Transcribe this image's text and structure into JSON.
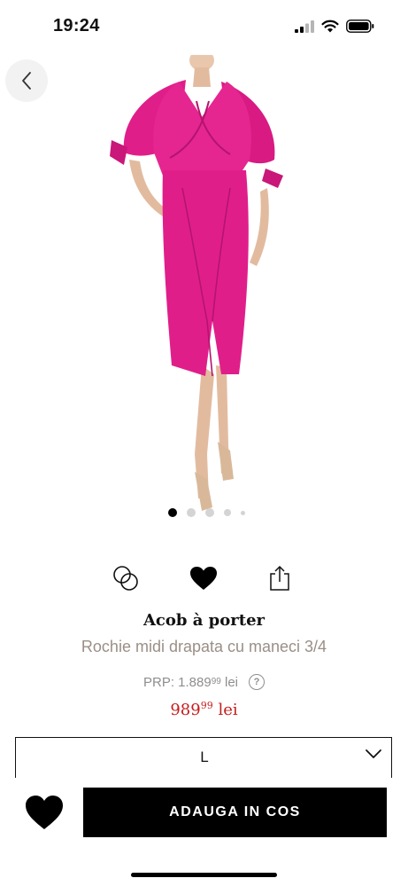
{
  "status_bar": {
    "time": "19:24"
  },
  "navigation": {
    "back_icon": "chevron-left-icon"
  },
  "gallery": {
    "image_alt": "product-photo-pink-satin-midi-dress",
    "dress_color": "#e01e8a",
    "dots_total": 5,
    "active_index": 0
  },
  "actions": {
    "compare_icon": "compare-circles-icon",
    "favorite_icon": "heart-icon",
    "share_icon": "share-icon"
  },
  "product": {
    "brand": "Acob à porter",
    "name": "Rochie midi drapata cu maneci 3/4",
    "prp_label": "PRP: 1.889",
    "prp_cents": "99",
    "prp_currency": "lei",
    "price_main": "989",
    "price_cents": "99",
    "price_currency": "lei",
    "price_color": "#c51d1d"
  },
  "size": {
    "selected": "L"
  },
  "cart": {
    "add_label": "ADAUGA IN COS"
  }
}
